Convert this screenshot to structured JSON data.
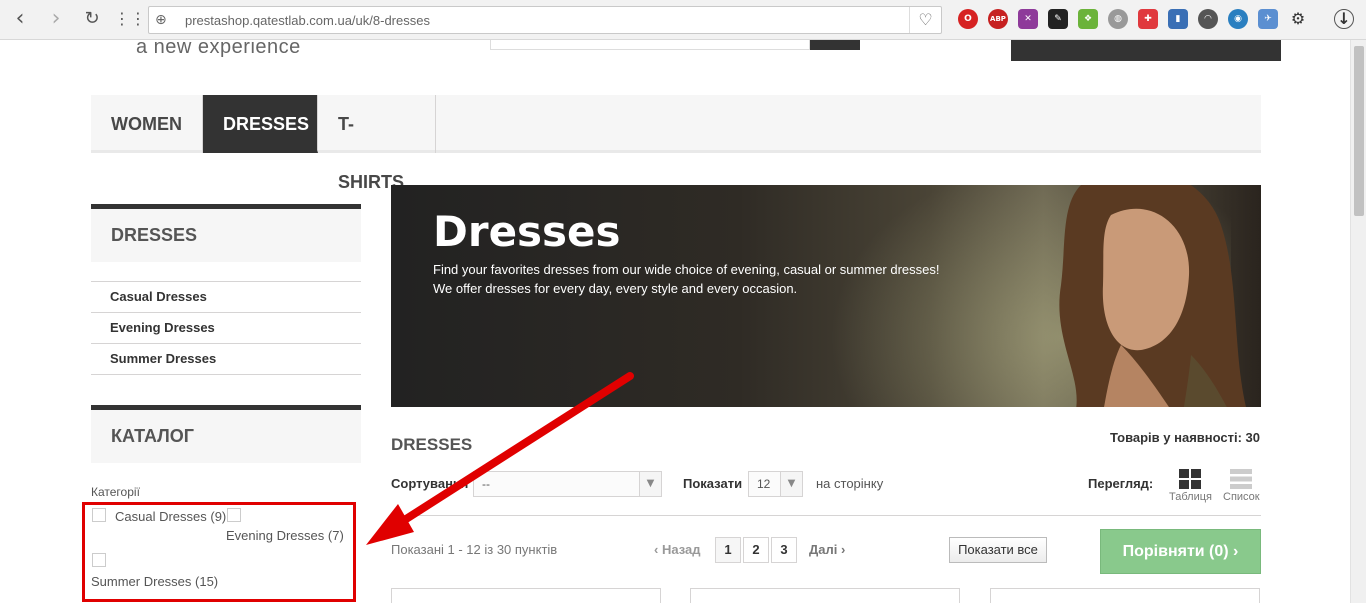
{
  "browser": {
    "url": "prestashop.qatestlab.com.ua/uk/8-dresses",
    "back_icon": "chevron-left",
    "forward_icon": "chevron-right",
    "reload_icon": "reload",
    "apps_icon": "grid",
    "favorite_icon": "heart",
    "extensions": [
      "opera-icon",
      "abp-icon",
      "x-icon",
      "edit-icon",
      "puzzle-icon",
      "globe-icon",
      "shield-icon",
      "book-icon",
      "headphones-icon",
      "vpn-icon",
      "badge-icon",
      "settings-icon",
      "download-icon"
    ]
  },
  "header": {
    "tagline": "a new experience"
  },
  "topmenu": {
    "items": [
      {
        "label": "Women"
      },
      {
        "label": "Dresses",
        "active": true
      },
      {
        "label": "T-shirts"
      }
    ]
  },
  "sidebar": {
    "category_title": "Dresses",
    "subcategories": [
      "Casual Dresses",
      "Evening Dresses",
      "Summer Dresses"
    ],
    "catalog_title": "Каталог",
    "filter_label": "Категорії",
    "filters": [
      "Casual Dresses (9)",
      "Evening Dresses (7)",
      "Summer Dresses (15)"
    ]
  },
  "banner": {
    "title": "Dresses",
    "line1": "Find your favorites dresses from our wide choice of evening, casual or summer dresses!",
    "line2": "We offer dresses for every day, every style and every occasion."
  },
  "listing": {
    "heading": "DRESSES",
    "count": "Товарів у наявності: 30",
    "sort_label": "Сортування",
    "sort_value": "--",
    "perpage_label": "Показати",
    "perpage_value": "12",
    "perpage_suffix": "на сторінку",
    "view_label": "Перегляд:",
    "view_grid": "Таблиця",
    "view_list": "Список",
    "showing": "Показані 1 - 12 із 30 пунктів",
    "prev": "Назад",
    "pages": [
      "1",
      "2",
      "3"
    ],
    "next": "Далі",
    "show_all": "Показати все",
    "compare": "Порівняти (0)"
  },
  "colors": {
    "annotation": "#e00000",
    "compare_button": "#89c98c"
  }
}
